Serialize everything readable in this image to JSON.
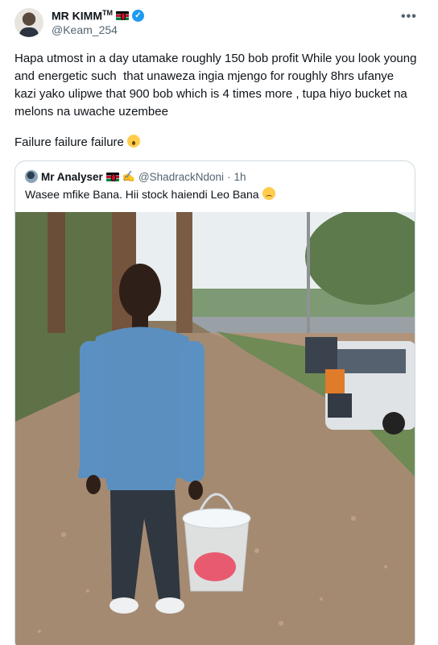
{
  "author": {
    "display_name": "MR KIMM",
    "tm": "TM",
    "handle": "@Keam_254",
    "verified": true
  },
  "more_label": "•••",
  "tweet": {
    "body": "Hapa utmost in a day utamake roughly 150 bob profit While you look young and energetic such  that unaweza ingia mjengo for roughly 8hrs ufanye kazi yako ulipwe that 900 bob which is 4 times more , tupa hiyo bucket na melons na uwache uzembee",
    "failure": "Failure failure failure",
    "failure_emoji": "astonished-face"
  },
  "quoted": {
    "display_name": "Mr Analyser",
    "handle": "@ShadrackNdoni",
    "separator": "·",
    "time": "1h",
    "text": "Wasee mfike Bana. Hii stock haiendi Leo Bana",
    "text_emoji": "sad-face",
    "photo_subject": "young man in blue sweater holding a clear bucket of watermelon slices by a roadside"
  },
  "colors": {
    "text": "#0f1419",
    "secondary": "#536471",
    "verified": "#1d9bf0",
    "border": "#cfd9de"
  }
}
